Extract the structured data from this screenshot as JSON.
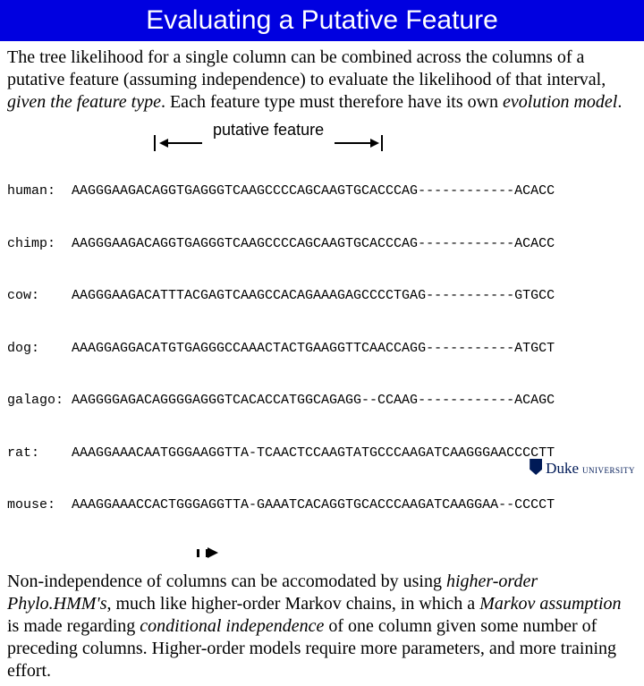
{
  "title": "Evaluating a Putative Feature",
  "para1": {
    "t1": "The tree likelihood for a single column can be combined across the columns of a putative feature (assuming independence) to evaluate the likelihood of that interval, ",
    "t2": "given the feature type",
    "t3": ". Each feature type must therefore have its own ",
    "t4": "evolution model",
    "t5": "."
  },
  "feature_label": "putative feature",
  "msa": [
    {
      "label": "human:",
      "seq": "AAGGGAAGACAGGTGAGGGTCAAGCCCCAGCAAGTGCACCCAG------------ACACC"
    },
    {
      "label": "chimp:",
      "seq": "AAGGGAAGACAGGTGAGGGTCAAGCCCCAGCAAGTGCACCCAG------------ACACC"
    },
    {
      "label": "cow:",
      "seq": "AAGGGAAGACATTTACGAGTCAAGCCACAGAAAGAGCCCCTGAG-----------GTGCC"
    },
    {
      "label": "dog:",
      "seq": "AAAGGAGGACATGTGAGGGCCAAACTACTGAAGGTTCAACCAGG-----------ATGCT"
    },
    {
      "label": "galago:",
      "seq": "AAGGGGAGACAGGGGAGGGTCACACCATGGCAGAGG--CCAAG------------ACAGC"
    },
    {
      "label": "rat:",
      "seq": "AAAGGAAACAATGGGAAGGTTA-TCAACTCCAAGTATGCCCAAGATCAAGGGAACCCCTT"
    },
    {
      "label": "mouse:",
      "seq": "AAAGGAAACCACTGGGAGGTTA-GAAATCACAGGTGCACCCAAGATCAAGGAA--CCCCT"
    }
  ],
  "para2": {
    "t1": "Non-independence of columns can be accomodated by using ",
    "t2": "higher-order Phylo.HMM's",
    "t3": ", much like higher-order Markov chains, in which a ",
    "t4": "Markov assumption",
    "t5": " is made regarding ",
    "t6": "conditional independence",
    "t7": " of one column given some number of preceding columns. Higher-order models require more parameters, and more training effort."
  },
  "logo": {
    "name": "Duke",
    "sub": "UNIVERSITY"
  }
}
